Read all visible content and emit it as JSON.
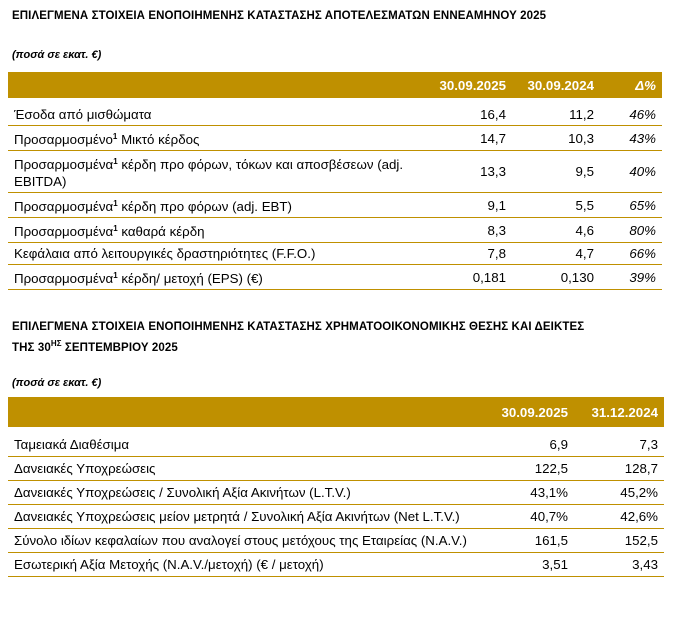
{
  "section1": {
    "title": "ΕΠΙΛΕΓΜΕΝΑ ΣΤΟΙΧΕΙΑ ΕΝΟΠΟΙΗΜΕΝΗΣ ΚΑΤΑΣΤΑΣΗΣ ΑΠΟΤΕΛΕΣΜΑΤΩΝ ΕΝΝΕΑΜΗΝΟΥ 2025",
    "unit": "(ποσά σε εκατ. €)",
    "headers": [
      "",
      "30.09.2025",
      "30.09.2024",
      "Δ%"
    ],
    "rows": [
      {
        "pre": "Έσοδα από μισθώματα",
        "sup": "",
        "post": "",
        "v1": "16,4",
        "v2": "11,2",
        "d": "46%"
      },
      {
        "pre": "Προσαρμοσμένο",
        "sup": "1",
        "post": " Μικτό κέρδος",
        "v1": "14,7",
        "v2": "10,3",
        "d": "43%"
      },
      {
        "pre": "Προσαρμοσμένα",
        "sup": "1",
        "post": " κέρδη προ φόρων, τόκων και αποσβέσεων (adj. EBITDA)",
        "v1": "13,3",
        "v2": "9,5",
        "d": "40%"
      },
      {
        "pre": "Προσαρμοσμένα",
        "sup": "1",
        "post": " κέρδη προ φόρων (adj. EBT)",
        "v1": "9,1",
        "v2": "5,5",
        "d": "65%"
      },
      {
        "pre": "Προσαρμοσμένα",
        "sup": "1",
        "post": " καθαρά κέρδη",
        "v1": "8,3",
        "v2": "4,6",
        "d": "80%"
      },
      {
        "pre": "Κεφάλαια από λειτουργικές δραστηριότητες (F.F.O.)",
        "sup": "",
        "post": "",
        "v1": "7,8",
        "v2": "4,7",
        "d": "66%"
      },
      {
        "pre": "Προσαρμοσμένα",
        "sup": "1",
        "post": " κέρδη/ μετοχή  (EPS) (€)",
        "v1": "0,181",
        "v2": "0,130",
        "d": "39%"
      }
    ]
  },
  "section2": {
    "title_line1": "ΕΠΙΛΕΓΜΕΝΑ ΣΤΟΙΧΕΙΑ ΕΝΟΠΟΙΗΜΕΝΗΣ ΚΑΤΑΣΤΑΣΗΣ ΧΡΗΜΑΤΟΟΙΚΟΝΟΜΙΚΗΣ ΘΕΣΗΣ ΚΑΙ ΔΕΙΚΤΕΣ",
    "title_line2_pre": "ΤΗΣ 30",
    "title_line2_sup": "ΗΣ",
    "title_line2_post": " ΣΕΠΤΕΜΒΡΙΟΥ 2025",
    "unit": "(ποσά σε εκατ. €)",
    "headers": [
      "",
      "30.09.2025",
      "31.12.2024"
    ],
    "rows": [
      {
        "label": "Ταμειακά Διαθέσιμα",
        "v1": "6,9",
        "v2": "7,3"
      },
      {
        "label": "Δανειακές Υποχρεώσεις",
        "v1": "122,5",
        "v2": "128,7"
      },
      {
        "label": "Δανειακές Υποχρεώσεις / Συνολική Αξία Ακινήτων (L.T.V.)",
        "v1": "43,1%",
        "v2": "45,2%"
      },
      {
        "label": "Δανειακές Υποχρεώσεις μείον μετρητά / Συνολική Αξία Ακινήτων (Net L.T.V.)",
        "v1": "40,7%",
        "v2": "42,6%"
      },
      {
        "label": "Σύνολο ιδίων κεφαλαίων που αναλογεί στους μετόχους της Εταιρείας (N.A.V.)",
        "v1": "161,5",
        "v2": "152,5"
      },
      {
        "label": "Εσωτερική Αξία Μετοχής (N.A.V./μετοχή) (€ / μετοχή)",
        "v1": "3,51",
        "v2": "3,43"
      }
    ]
  }
}
